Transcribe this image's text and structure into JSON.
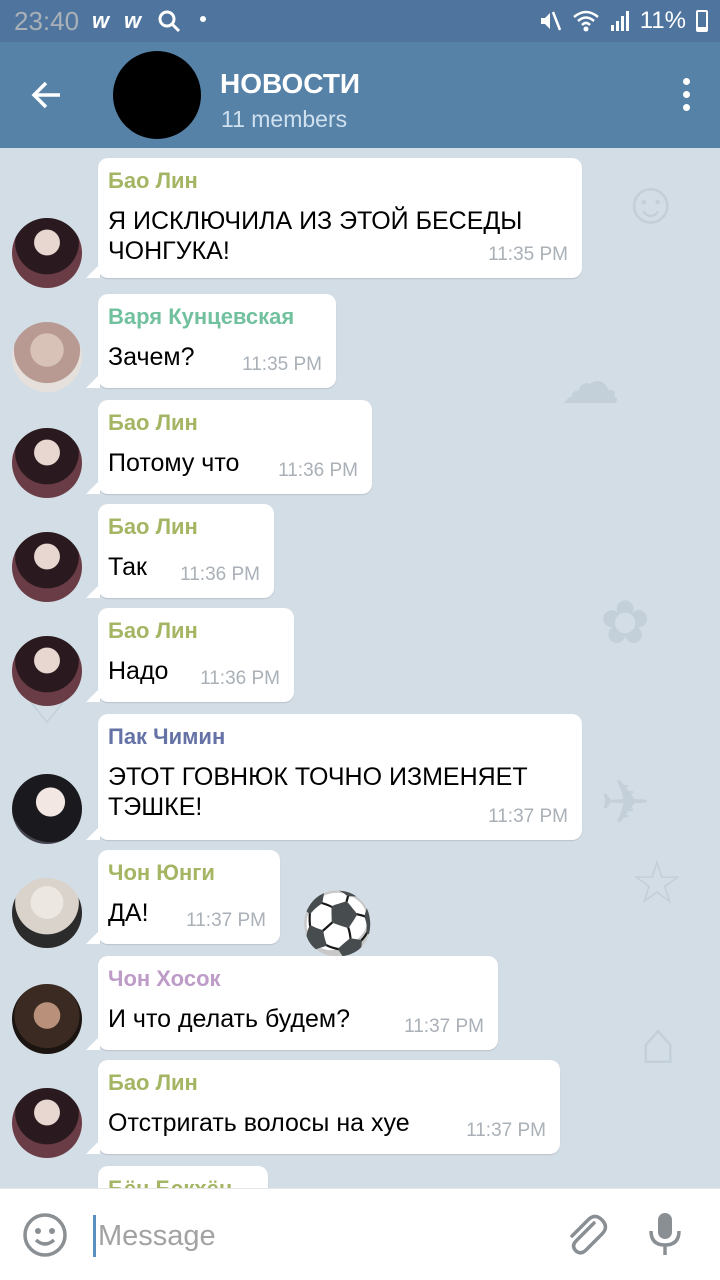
{
  "status_bar": {
    "time": "23:40",
    "notifications": [
      "w",
      "w"
    ],
    "battery": "11%",
    "icons": [
      "mute-icon",
      "wifi-icon",
      "signal-icon",
      "battery-icon",
      "search-icon"
    ]
  },
  "header": {
    "title": "НОВОСТИ",
    "subtitle": "11 members",
    "background": "#5682a8"
  },
  "messages": [
    {
      "sender": "Бао Лин",
      "sender_color": "#a4b563",
      "avatar": "bao",
      "text_lines": [
        "Я ИСКЛЮЧИЛА ИЗ ЭТОЙ БЕСЕДЫ",
        "ЧОНГУКА!"
      ],
      "time": "11:35 PM"
    },
    {
      "sender": "Варя Кунцевская",
      "sender_color": "#72c19e",
      "avatar": "varya",
      "text_lines": [
        "Зачем?"
      ],
      "time": "11:35 PM"
    },
    {
      "sender": "Бао Лин",
      "sender_color": "#a4b563",
      "avatar": "bao",
      "text_lines": [
        "Потому что"
      ],
      "time": "11:36 PM"
    },
    {
      "sender": "Бао Лин",
      "sender_color": "#a4b563",
      "avatar": "bao",
      "text_lines": [
        "Так"
      ],
      "time": "11:36 PM"
    },
    {
      "sender": "Бао Лин",
      "sender_color": "#a4b563",
      "avatar": "bao",
      "text_lines": [
        "Надо"
      ],
      "time": "11:36 PM"
    },
    {
      "sender": "Пак  Чимин",
      "sender_color": "#6572a6",
      "avatar": "park",
      "text_lines": [
        "ЭТОТ ГОВНЮК ТОЧНО ИЗМЕНЯЕТ",
        "ТЭШКЕ!"
      ],
      "time": "11:37 PM"
    },
    {
      "sender": "Чон Юнги",
      "sender_color": "#a4b563",
      "avatar": "yoongi",
      "text_lines": [
        "ДА!"
      ],
      "time": "11:37 PM"
    },
    {
      "sender": "Чон  Хосок",
      "sender_color": "#bd9cc8",
      "avatar": "hoseok",
      "text_lines": [
        "И что делать будем?"
      ],
      "time": "11:37 PM"
    },
    {
      "sender": "Бао Лин",
      "sender_color": "#a4b563",
      "avatar": "bao",
      "text_lines": [
        "Отстригать волосы на хуе"
      ],
      "time": "11:37 PM"
    },
    {
      "sender": "Бён Бэкхён",
      "sender_color": "#a4b563",
      "avatar": "none",
      "text_lines": [],
      "time": ""
    }
  ],
  "input": {
    "placeholder": "Message"
  }
}
